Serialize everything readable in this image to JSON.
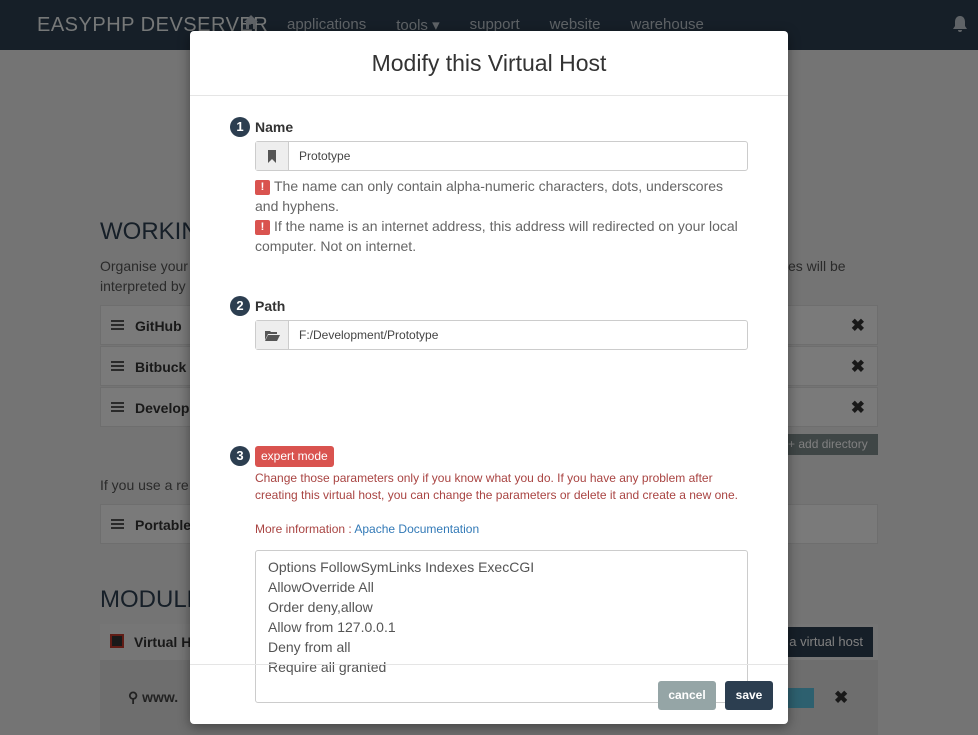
{
  "nav": {
    "brand": "EASYPHP DEVSERVER",
    "links": [
      "applications",
      "tools ▾",
      "support",
      "website",
      "warehouse"
    ]
  },
  "background": {
    "working_title": "WORKIN",
    "working_desc_left": "Organise your",
    "working_desc_left2": "interpreted by",
    "working_desc_right": "es will be",
    "dirs": [
      "GitHub",
      "Bitbuck",
      "Develop"
    ],
    "add_directory": "+ add directory",
    "remote_note": "If you use a re",
    "portable": "Portable",
    "modules_title": "MODULE",
    "module_name": "Virtual H",
    "add_vhost": "a virtual host",
    "link_row": "www."
  },
  "modal": {
    "title": "Modify this Virtual Host",
    "name_step": {
      "num": "1",
      "label": "Name",
      "value": "Prototype"
    },
    "name_warnings": [
      "The name can only contain alpha-numeric characters, dots, underscores and hyphens.",
      "If the name is an internet address, this address will redirected on your local computer. Not on internet."
    ],
    "path_step": {
      "num": "2",
      "label": "Path",
      "value": "F:/Development/Prototype"
    },
    "expert_step": {
      "num": "3",
      "badge": "expert mode",
      "warning": "Change those parameters only if you know what you do. If you have any problem after creating this virtual host, you can change the parameters or delete it and create a new one.",
      "more_info_label": "More information : ",
      "more_info_link": "Apache Documentation"
    },
    "config_lines": [
      "Options FollowSymLinks Indexes ExecCGI",
      "AllowOverride All",
      "Order deny,allow",
      "Allow from 127.0.0.1",
      "Deny from all",
      "Require all granted"
    ],
    "cancel_label": "cancel",
    "save_label": "save",
    "warning_icon": "!",
    "icons": {
      "name_addon": "bookmark-icon",
      "path_addon": "folder-open-icon"
    }
  },
  "colors": {
    "navbar": "#2c3e50",
    "danger": "#d9534f",
    "link": "#337ab7",
    "cancel": "#95a5a6",
    "save": "#2c3e50"
  }
}
